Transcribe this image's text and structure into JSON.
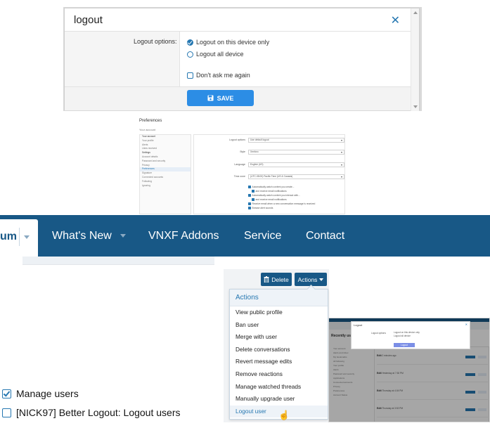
{
  "dialog": {
    "title": "logout",
    "options_label": "Logout options:",
    "option_this_device": "Logout on this device only",
    "option_all_devices": "Logout all device",
    "dont_ask": "Don't ask me again",
    "save_label": "SAVE"
  },
  "prefs": {
    "title": "Preferences",
    "subtitle": "Your account",
    "sidebar": [
      "Your account",
      "Your profile",
      "Alerts",
      "Likes received",
      "Settings",
      "Account details",
      "Password and security",
      "Privacy",
      "Preferences",
      "Signature",
      "Connected accounts",
      "Following",
      "Ignoring"
    ],
    "fields": [
      {
        "label": "Logout options",
        "value": "Use default logout"
      },
      {
        "label": "Style",
        "value": "Xenforo"
      },
      {
        "label": "Language",
        "value": "English (US)"
      },
      {
        "label": "Time zone",
        "value": "(UTC-08:00) Pacific Time (US & Canada)"
      }
    ],
    "checks": [
      "Automatically watch content you create...",
      "and receive email notifications",
      "Automatically watch content you interact with...",
      "and receive email notifications",
      "Receive email when a new conversation message is received",
      "Browse alert sounds"
    ]
  },
  "nav": {
    "forum_tab": "um",
    "items": [
      "What's New",
      "VNXF Addons",
      "Service",
      "Contact"
    ]
  },
  "actions": {
    "delete_label": "Delete",
    "actions_label": "Actions",
    "menu_header": "Actions",
    "menu_items": [
      "View public profile",
      "Ban user",
      "Merge with user",
      "Delete conversations",
      "Revert message edits",
      "Remove reactions",
      "Manage watched threads",
      "Manually upgrade user",
      "Logout user"
    ]
  },
  "mini": {
    "page_title": "Recently us",
    "dialog_title": "Logout",
    "dialog_label": "Logout options",
    "dialog_opt1": "Logout on this device only",
    "dialog_opt2": "Logout all device",
    "dialog_btn": "Logout",
    "sidebar": [
      "Your account",
      "Alerts and inbox",
      "My bookmarks",
      "All following",
      "Your profile",
      "Alerts",
      "Password and security",
      "Applications",
      "Connected accounts",
      "Privacy",
      "Preferences",
      "Account Status"
    ],
    "rows": [
      {
        "name": "Edit",
        "when": "2 minutes ago"
      },
      {
        "name": "Edit",
        "when": "Yesterday at 7:30 PM"
      },
      {
        "name": "Edit",
        "when": "Thursday at 4:04 PM"
      },
      {
        "name": "Edit",
        "when": "Thursday at 3:52 PM"
      }
    ]
  },
  "permissions": [
    {
      "label": "Manage users",
      "checked": true
    },
    {
      "label": "[NICK97] Better Logout: Logout users",
      "checked": false
    }
  ],
  "colors": {
    "brand": "#185886",
    "accent": "#2577b1",
    "save_button": "#2c8de5"
  },
  "icons": [
    "close-icon",
    "check-radio-icon",
    "radio-icon",
    "checkbox-icon",
    "save-icon",
    "trash-icon",
    "caret-down-icon",
    "hand-cursor-icon"
  ]
}
